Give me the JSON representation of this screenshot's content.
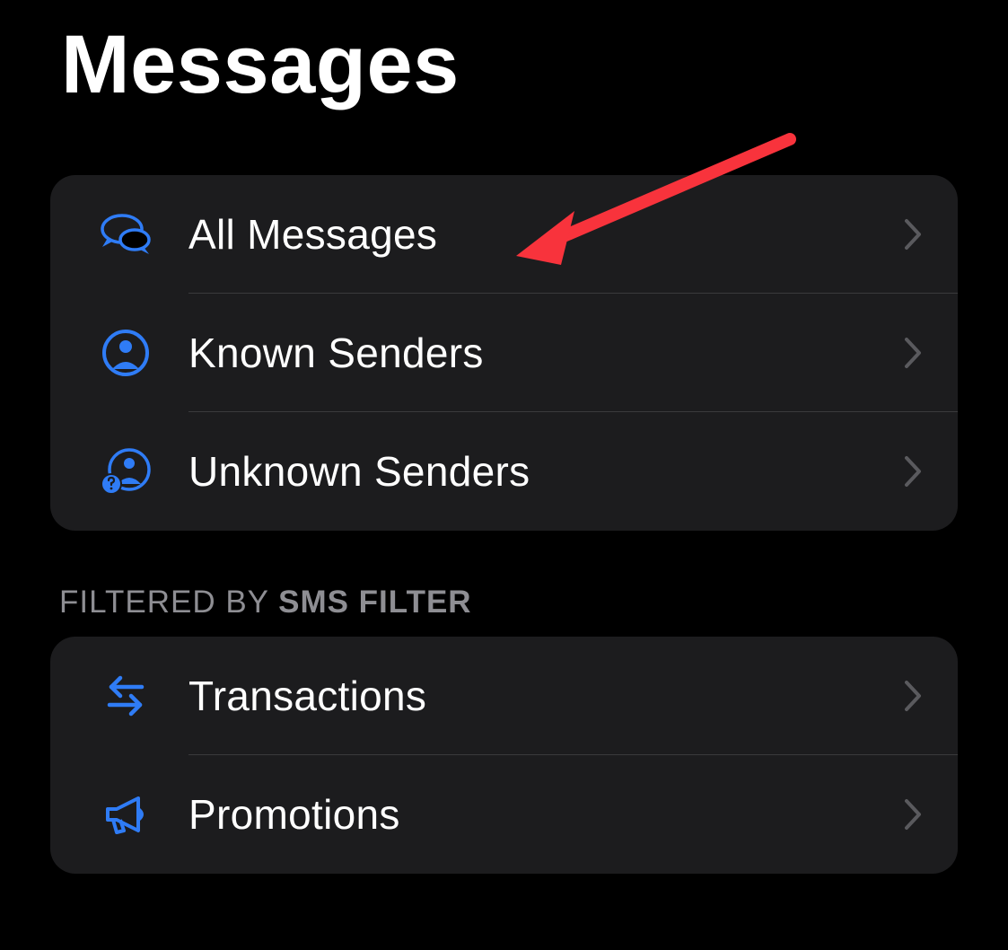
{
  "title": "Messages",
  "sections": [
    {
      "header_prefix": "",
      "header_bold": "",
      "items": [
        {
          "icon": "chat-bubbles",
          "label": "All Messages"
        },
        {
          "icon": "person-circle",
          "label": "Known Senders"
        },
        {
          "icon": "person-question",
          "label": "Unknown Senders"
        }
      ]
    },
    {
      "header_prefix": "Filtered by ",
      "header_bold": "SMS Filter",
      "items": [
        {
          "icon": "arrows-swap",
          "label": "Transactions"
        },
        {
          "icon": "megaphone",
          "label": "Promotions"
        }
      ]
    }
  ],
  "colors": {
    "accent": "#2f7cf6",
    "background": "#000000",
    "group": "#1c1c1e",
    "secondary": "#8e8e93",
    "annotation": "#f8333c"
  }
}
